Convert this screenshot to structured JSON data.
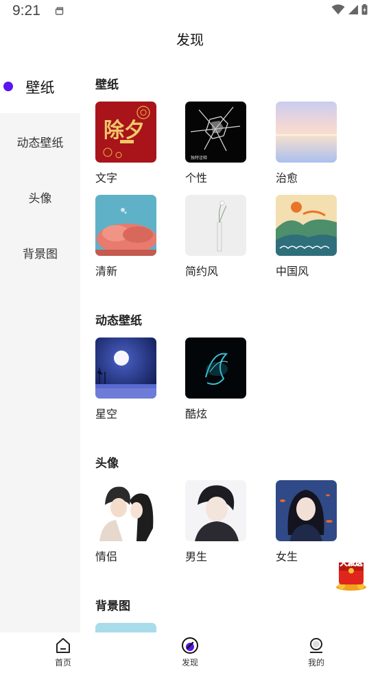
{
  "status_bar": {
    "time": "9:21",
    "icons": [
      "app-notification-icon",
      "wifi-icon",
      "signal-icon",
      "battery-icon"
    ]
  },
  "header": {
    "title": "发现"
  },
  "sidebar": {
    "items": [
      {
        "label": "壁纸",
        "active": true
      },
      {
        "label": "动态壁纸",
        "active": false
      },
      {
        "label": "头像",
        "active": false
      },
      {
        "label": "背景图",
        "active": false
      }
    ],
    "active_color": "#5a15f0"
  },
  "sections": [
    {
      "title": "壁纸",
      "items": [
        {
          "label": "文字",
          "thumb_text": "除夕"
        },
        {
          "label": "个性",
          "thumb_text": "独特诠释"
        },
        {
          "label": "治愈"
        },
        {
          "label": "清新"
        },
        {
          "label": "简约风"
        },
        {
          "label": "中国风"
        }
      ]
    },
    {
      "title": "动态壁纸",
      "items": [
        {
          "label": "星空"
        },
        {
          "label": "酷炫"
        }
      ]
    },
    {
      "title": "头像",
      "items": [
        {
          "label": "情侣"
        },
        {
          "label": "男生"
        },
        {
          "label": "女生"
        }
      ]
    },
    {
      "title": "背景图",
      "items": []
    }
  ],
  "promo_badge": {
    "line1": "红包",
    "line2": "大派送"
  },
  "bottom_nav": {
    "items": [
      {
        "label": "首页",
        "icon": "home-icon"
      },
      {
        "label": "发现",
        "icon": "discover-icon",
        "active": true
      },
      {
        "label": "我的",
        "icon": "profile-icon"
      }
    ]
  }
}
